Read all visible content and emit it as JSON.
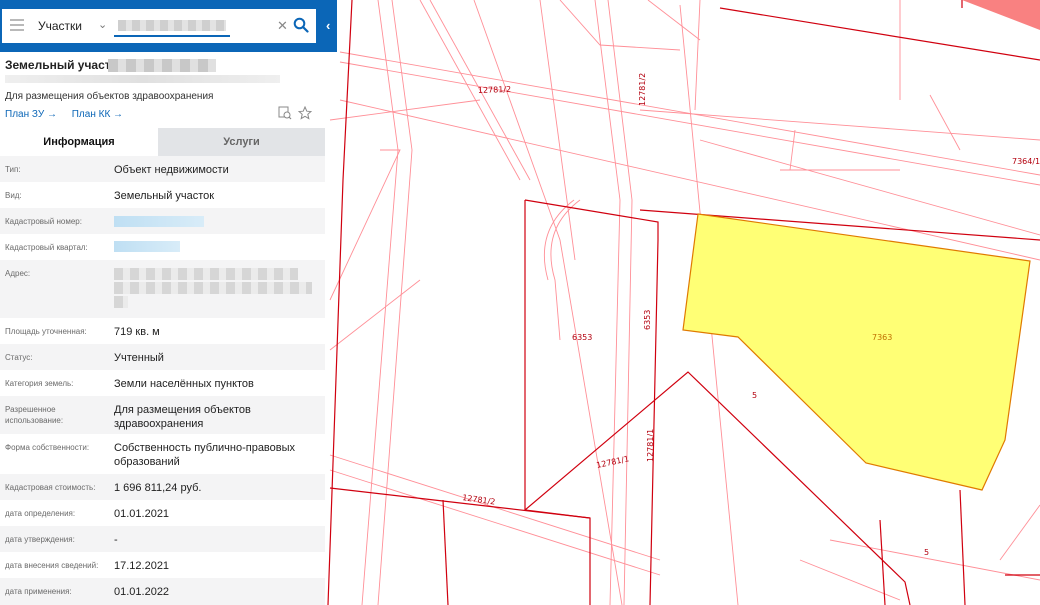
{
  "search": {
    "layer": "Участки"
  },
  "card": {
    "title": "Земельный участок",
    "purpose": "Для размещения объектов здравоохранения",
    "links": [
      "План ЗУ →",
      "План КК →"
    ]
  },
  "tabs": [
    "Информация",
    "Услуги"
  ],
  "properties": [
    {
      "label": "Тип:",
      "value": "Объект недвижимости"
    },
    {
      "label": "Вид:",
      "value": "Земельный участок"
    },
    {
      "label": "Кадастровый номер:",
      "value": ""
    },
    {
      "label": "Кадастровый квартал:",
      "value": ""
    },
    {
      "label": "Адрес:",
      "value": ""
    },
    {
      "label": "Площадь уточненная:",
      "value": "719 кв. м"
    },
    {
      "label": "Статус:",
      "value": "Учтенный"
    },
    {
      "label": "Категория земель:",
      "value": "Земли населённых пунктов"
    },
    {
      "label": "Разрешенное использование:",
      "value": "Для размещения объектов здравоохранения"
    },
    {
      "label": "Форма собственности:",
      "value": "Собственность публично-правовых образований"
    },
    {
      "label": "Кадастровая стоимость:",
      "value": "1 696 811,24 руб."
    },
    {
      "label": "дата определения:",
      "value": "01.01.2021"
    },
    {
      "label": "дата утверждения:",
      "value": "-"
    },
    {
      "label": "дата внесения сведений:",
      "value": "17.12.2021"
    },
    {
      "label": "дата применения:",
      "value": "01.01.2022"
    }
  ],
  "map_labels": [
    "12781/2",
    "12781/2",
    "7364/1",
    "6353",
    "6353",
    "7363",
    "5",
    "12781/1",
    "12781/1",
    "12781/2",
    "5"
  ],
  "colors": {
    "accent": "#0b66b7",
    "parcel_fill": "#ffff75",
    "boundary": "#d0000f"
  }
}
